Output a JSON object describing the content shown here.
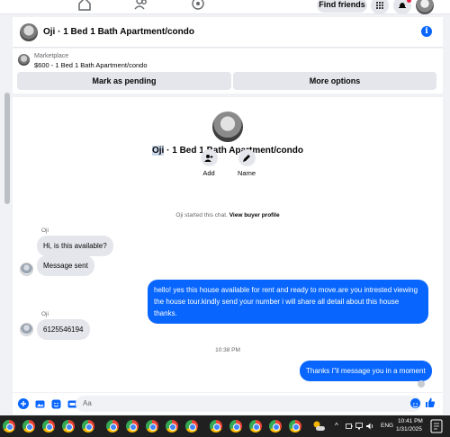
{
  "topnav": {
    "find_friends": "Find friends"
  },
  "header": {
    "title": "Oji · 1 Bed 1 Bath Apartment/condo",
    "info_glyph": "i"
  },
  "marketplace": {
    "label": "Marketplace",
    "listing": "$600 - 1 Bed 1 Bath Apartment/condo",
    "pending_button": "Mark as pending",
    "more_button": "More options"
  },
  "profile": {
    "title_highlight": "Oji",
    "title_rest": " · 1 Bed 1 Bath Apartment/condo",
    "add_label": "Add",
    "name_label": "Name"
  },
  "started": {
    "text": "Oji started this chat.",
    "link": "View buyer profile"
  },
  "messages": {
    "m1_sender": "Oji",
    "m1_text": "Hi, is this available?",
    "m2_text": "Message sent",
    "m3_text": "hello! yes this house available for rent and ready to move.are you intrested viewing the house tour.kindly send your number i will share all detail about this house thanks.",
    "m4_sender": "Oji",
    "m4_text": "6125546194",
    "timestamp": "10:38 PM",
    "m5_text": "Thanks i\"il message you in a moment"
  },
  "composer": {
    "placeholder": "Aa"
  },
  "taskbar": {
    "lang": "ENG",
    "time": "10:41 PM",
    "date": "1/31/2025",
    "chevron": "^"
  },
  "colors": {
    "accent": "#0866ff",
    "bubble_in": "#e4e6eb",
    "background": "#f0f2f5"
  },
  "icons": [
    "home-icon",
    "people-icon",
    "gaming-icon",
    "grid-menu-icon",
    "bell-icon",
    "account-avatar",
    "info-icon",
    "add-person-icon",
    "pencil-icon",
    "plus-icon",
    "photo-icon",
    "sticker-icon",
    "gif-icon",
    "emoji-icon",
    "thumbs-up-icon"
  ]
}
